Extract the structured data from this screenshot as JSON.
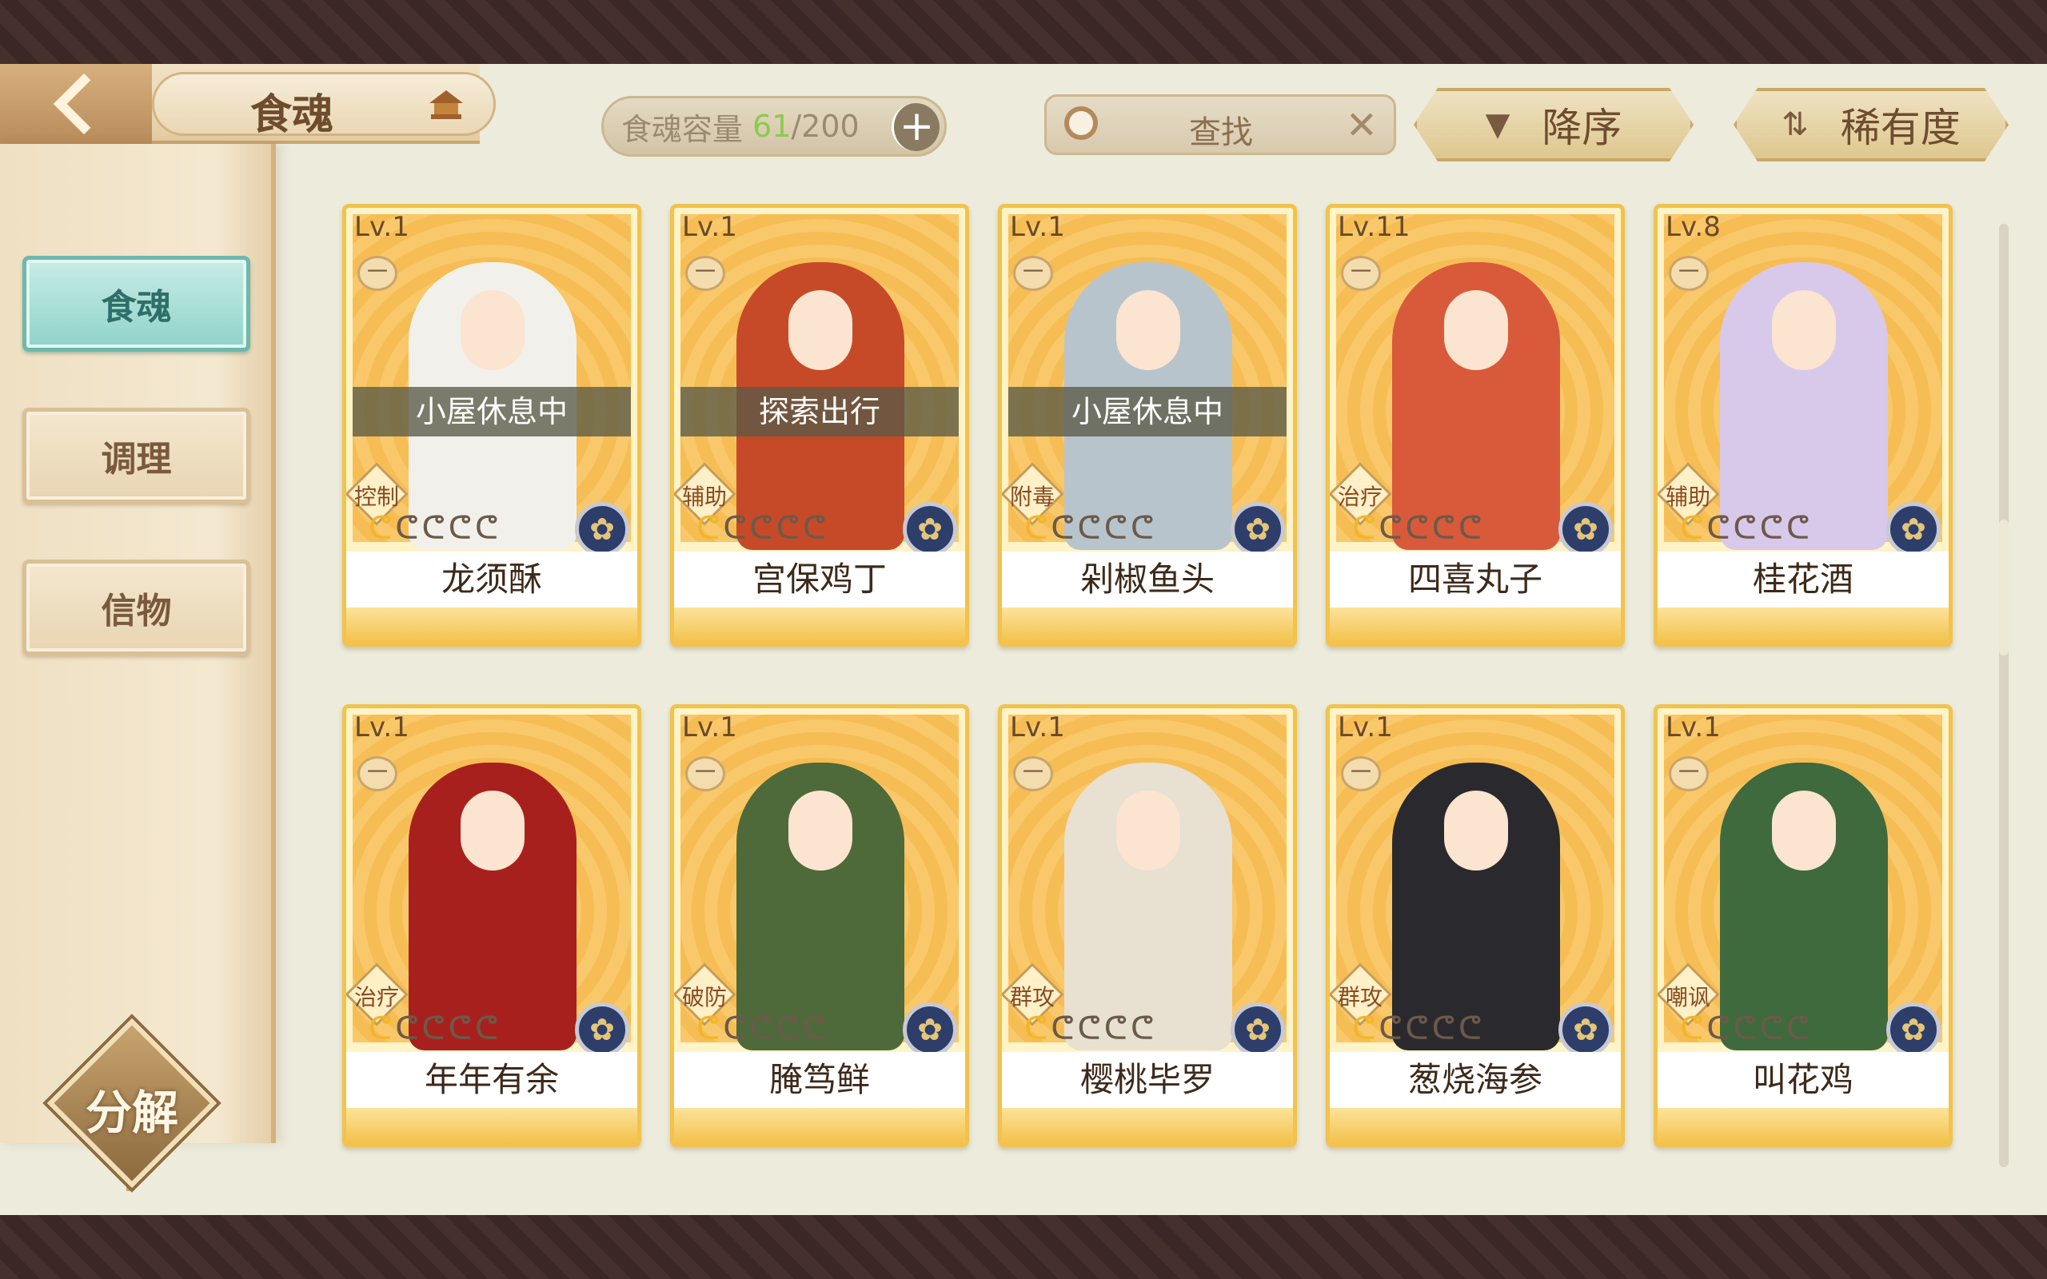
{
  "header": {
    "title": "食魂",
    "capacity_label": "食魂容量",
    "capacity_current": "61",
    "capacity_sep": "/200",
    "capacity_plus": "+",
    "search_placeholder": "查找",
    "search_clear": "✕",
    "sort_order_label": "降序",
    "sort_order_icon": "▼",
    "sort_by_label": "稀有度",
    "sort_by_icon": "⇅"
  },
  "sidebar": {
    "items": [
      {
        "label": "食魂",
        "active": true
      },
      {
        "label": "调理",
        "active": false
      },
      {
        "label": "信物",
        "active": false
      }
    ],
    "decompose_label": "分解"
  },
  "cards": [
    {
      "level": "Lv.1",
      "lock": "一",
      "status": "小屋休息中",
      "role": "控制",
      "stars_on": 1,
      "name": "龙须酥",
      "figure_color": "#f2f0ea",
      "face": "#fbe4d0"
    },
    {
      "level": "Lv.1",
      "lock": "一",
      "status": "探索出行",
      "role": "辅助",
      "stars_on": 1,
      "name": "宫保鸡丁",
      "figure_color": "#c64a28",
      "face": "#fbe4d0"
    },
    {
      "level": "Lv.1",
      "lock": "一",
      "status": "小屋休息中",
      "role": "附毒",
      "stars_on": 1,
      "name": "剁椒鱼头",
      "figure_color": "#b8c4cc",
      "face": "#fbe4d0"
    },
    {
      "level": "Lv.11",
      "lock": "一",
      "status": "",
      "role": "治疗",
      "stars_on": 1,
      "name": "四喜丸子",
      "figure_color": "#d85a3a",
      "face": "#fbe4d0"
    },
    {
      "level": "Lv.8",
      "lock": "一",
      "status": "",
      "role": "辅助",
      "stars_on": 1,
      "name": "桂花酒",
      "figure_color": "#d8c8ea",
      "face": "#fbe4d0"
    },
    {
      "level": "Lv.1",
      "lock": "一",
      "status": "",
      "role": "治疗",
      "stars_on": 1,
      "name": "年年有余",
      "figure_color": "#a8201e",
      "face": "#fbe4d0"
    },
    {
      "level": "Lv.1",
      "lock": "一",
      "status": "",
      "role": "破防",
      "stars_on": 1,
      "name": "腌笃鲜",
      "figure_color": "#4f6a3a",
      "face": "#fbe4d0"
    },
    {
      "level": "Lv.1",
      "lock": "一",
      "status": "",
      "role": "群攻",
      "stars_on": 1,
      "name": "樱桃毕罗",
      "figure_color": "#e8e0d0",
      "face": "#fbe4d0"
    },
    {
      "level": "Lv.1",
      "lock": "一",
      "status": "",
      "role": "群攻",
      "stars_on": 1,
      "name": "葱烧海参",
      "figure_color": "#2a2a2e",
      "face": "#fbe4d0"
    },
    {
      "level": "Lv.1",
      "lock": "一",
      "status": "",
      "role": "嘲讽",
      "stars_on": 1,
      "name": "叫花鸡",
      "figure_color": "#3e6a3e",
      "face": "#fbe4d0"
    }
  ],
  "icons": {
    "rank_glyph": "ᕦ",
    "emblem_glyph": "✿",
    "back": "chevron-left-icon",
    "search": "search-icon"
  }
}
